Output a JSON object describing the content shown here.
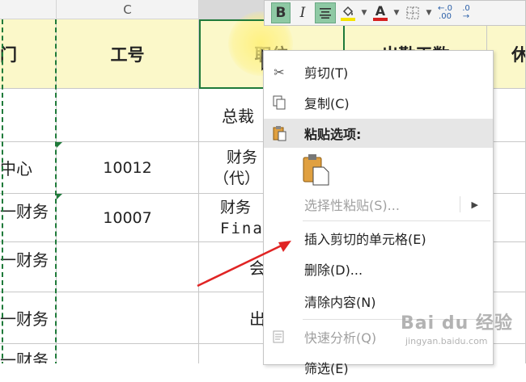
{
  "spreadsheet": {
    "column_c_label": "C",
    "headers": {
      "col_a_partial": "门",
      "employee_id": "工号",
      "position": "职位",
      "attendance_days": "出勤天数",
      "rest_partial": "休"
    },
    "rows": [
      {
        "dept": "",
        "id": "",
        "position": "总裁"
      },
      {
        "dept": "中心",
        "id": "10012",
        "position_line1": "财务",
        "position_line2": "（代）"
      },
      {
        "dept": "一财务",
        "id": "10007",
        "position_line1": "财务",
        "position_line2": "Fina"
      },
      {
        "dept": "一财务",
        "id": "",
        "position": "会"
      },
      {
        "dept": "一财务",
        "id": "",
        "position": "出"
      },
      {
        "dept": "一财务",
        "id": "",
        "position": ""
      }
    ]
  },
  "toolbar": {
    "bold": "B",
    "italic": "I",
    "font_color_letter": "A",
    "highlight_color": "#f5e400",
    "font_color": "#d42020",
    "accent_color": "#8ec9a4"
  },
  "context_menu": {
    "items": [
      {
        "label": "剪切(T)",
        "icon": "scissors-icon",
        "enabled": true
      },
      {
        "label": "复制(C)",
        "icon": "copy-icon",
        "enabled": true
      },
      {
        "label": "粘贴选项:",
        "icon": "paste-icon",
        "enabled": true
      },
      {
        "label": "选择性粘贴(S)...",
        "icon": "",
        "enabled": false
      },
      {
        "label": "插入剪切的单元格(E)",
        "icon": "",
        "enabled": true
      },
      {
        "label": "删除(D)...",
        "icon": "",
        "enabled": true
      },
      {
        "label": "清除内容(N)",
        "icon": "",
        "enabled": true
      },
      {
        "label": "快速分析(Q)",
        "icon": "quick-analysis-icon",
        "enabled": false
      },
      {
        "label": "筛选(E)",
        "icon": "",
        "enabled": true
      }
    ]
  },
  "watermark": {
    "main": "Bai du 经验",
    "sub": "jingyan.baidu.com"
  }
}
